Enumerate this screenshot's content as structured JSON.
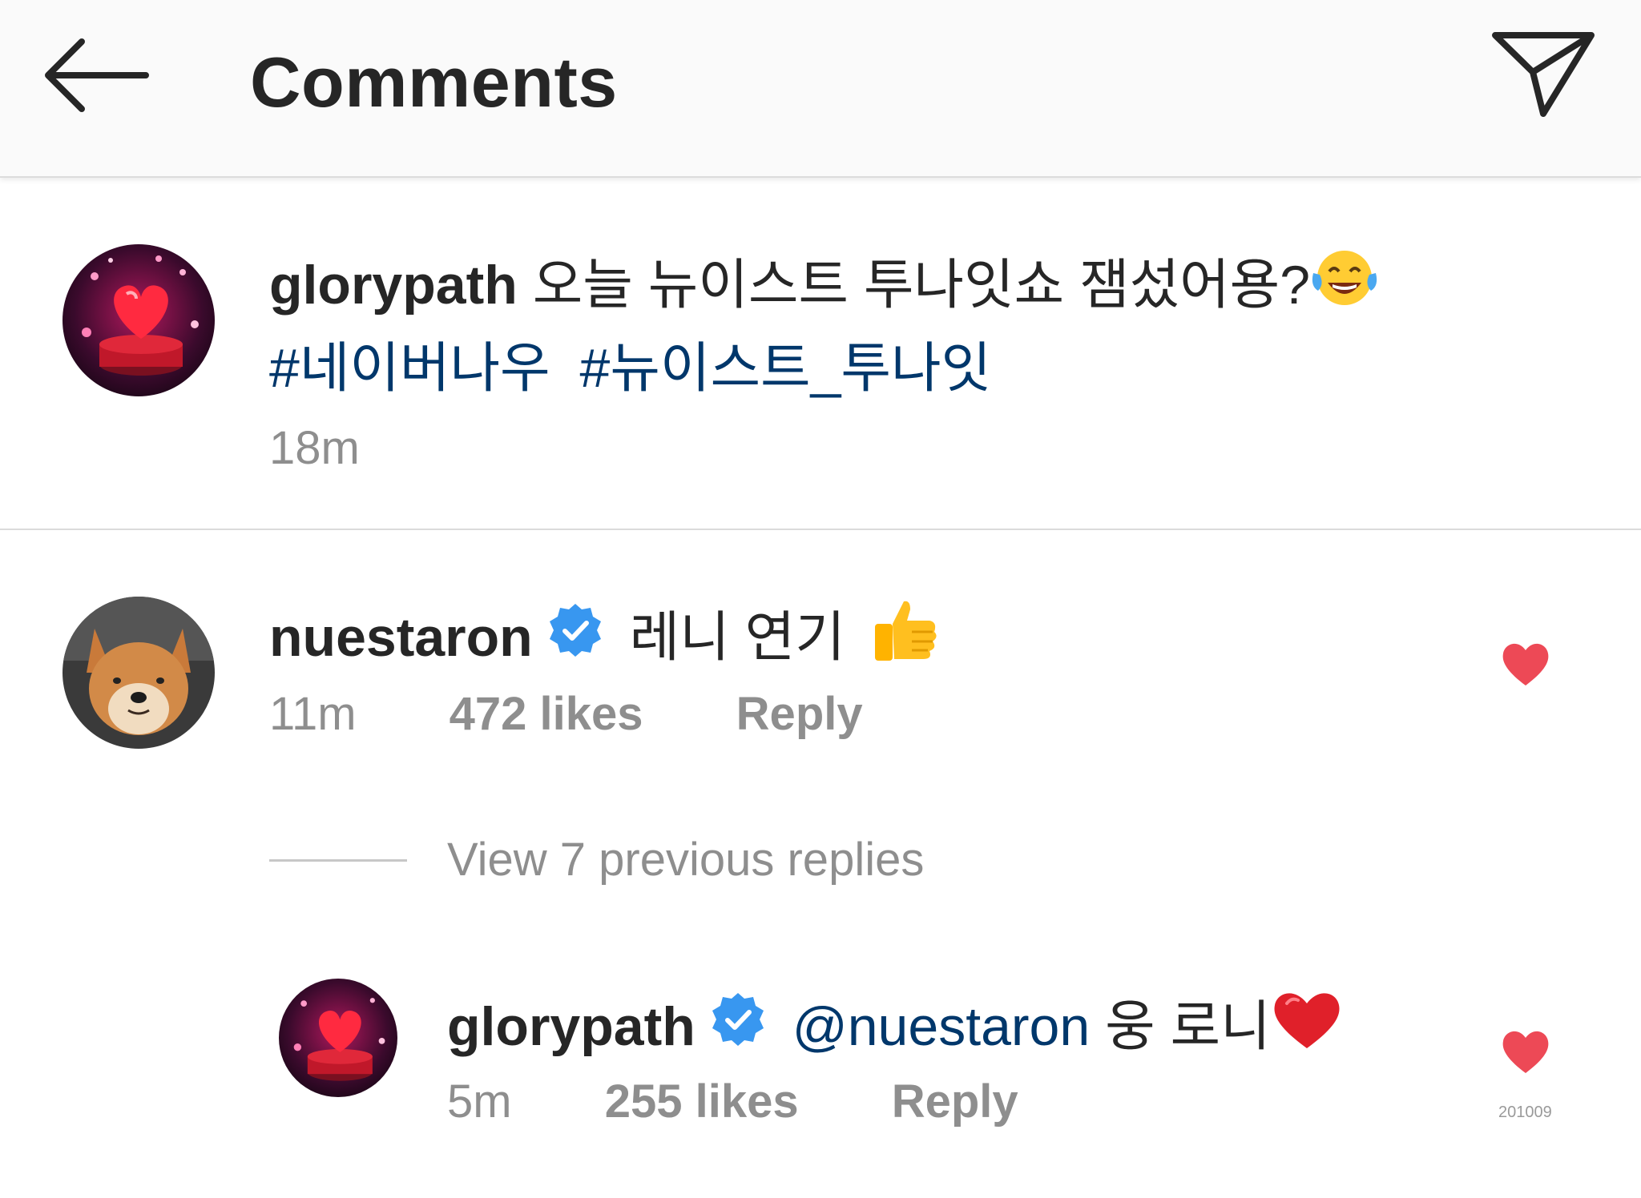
{
  "header": {
    "title": "Comments",
    "back_icon": "arrow-left-icon",
    "share_icon": "paper-plane-icon"
  },
  "caption": {
    "username": "glorypath",
    "text": "오늘 뉴이스트 투나잇쇼 잼섰어용?",
    "emoji": "tears-of-joy-emoji",
    "hashtags": [
      "#네이버나우",
      "#뉴이스트_투나잇"
    ],
    "time": "18m"
  },
  "comments": [
    {
      "username": "nuestaron",
      "verified": true,
      "text": "레니 연기",
      "emoji": "thumbs-up-emoji",
      "time": "11m",
      "likes": "472 likes",
      "reply": "Reply",
      "liked": true
    }
  ],
  "view_replies": "View 7 previous replies",
  "reply": {
    "username": "glorypath",
    "verified": true,
    "mention": "@nuestaron",
    "text": "웅 로니",
    "emoji": "red-heart-emoji",
    "time": "5m",
    "likes": "255 likes",
    "reply": "Reply",
    "liked": true
  },
  "watermark": "201009",
  "colors": {
    "link": "#00376b",
    "meta": "#8e8e8e",
    "heart": "#ed4956",
    "verified": "#3897f0",
    "header_bg": "#fafafa"
  }
}
